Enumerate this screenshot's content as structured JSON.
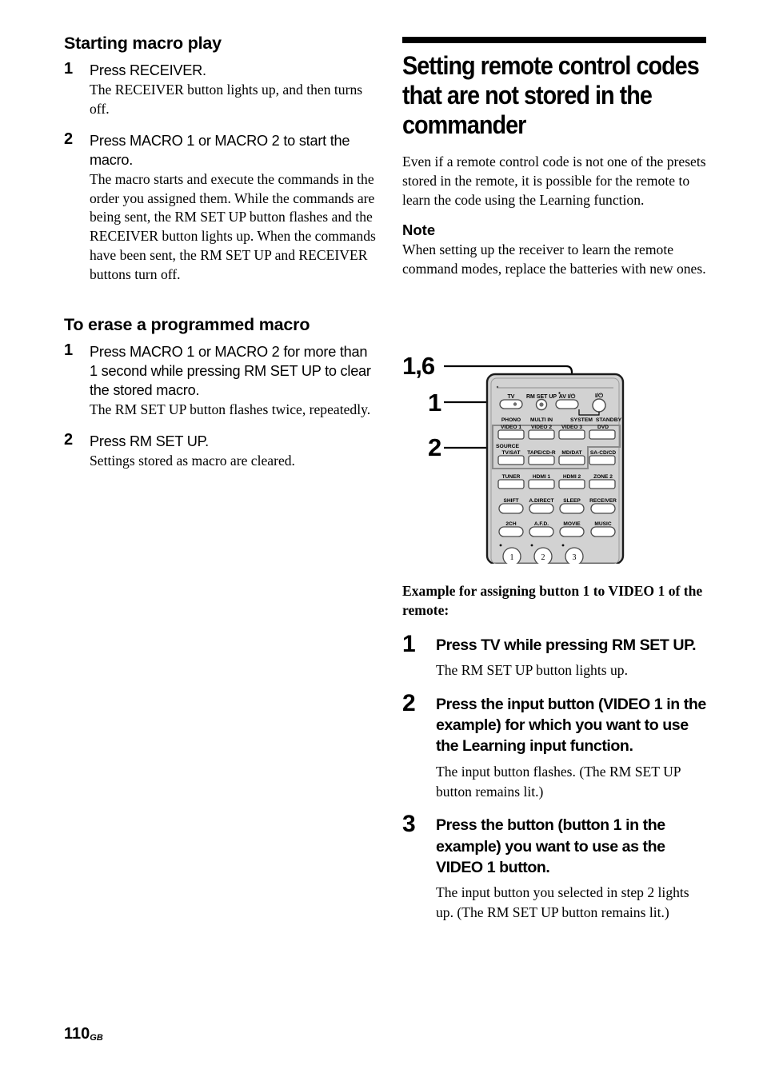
{
  "page": {
    "number": "110",
    "region_code": "GB"
  },
  "left_column": {
    "section1": {
      "heading": "Starting macro play",
      "steps": [
        {
          "num": "1",
          "title": "Press RECEIVER.",
          "body": "The RECEIVER button lights up, and then turns off."
        },
        {
          "num": "2",
          "title": "Press MACRO 1 or MACRO 2 to start the macro.",
          "body": "The macro starts and execute the commands in the order you assigned them. While the commands are being sent, the RM SET UP button flashes and the RECEIVER button lights up. When the commands have been sent, the RM SET UP and RECEIVER buttons turn off."
        }
      ]
    },
    "section2": {
      "heading": "To erase a programmed macro",
      "steps": [
        {
          "num": "1",
          "title": "Press MACRO 1 or MACRO 2 for more than 1 second while pressing RM SET UP to clear the stored macro.",
          "body": "The RM SET UP button flashes twice, repeatedly."
        },
        {
          "num": "2",
          "title": "Press RM SET UP.",
          "body": "Settings stored as macro are cleared."
        }
      ]
    }
  },
  "right_column": {
    "heading": "Setting remote control codes that are not stored in the commander",
    "intro": "Even if a remote control code is not one of the presets stored in the remote, it is possible for the remote to learn the code using the Learning function.",
    "note_heading": "Note",
    "note_body": "When setting up the receiver to learn the remote command modes, replace the batteries with new ones.",
    "example_heading": "Example for assigning button 1 to VIDEO 1 of the remote:",
    "steps": [
      {
        "num": "1",
        "title": "Press TV while pressing RM SET UP.",
        "body": "The RM SET UP button lights up."
      },
      {
        "num": "2",
        "title": "Press the input button (VIDEO 1 in the example) for which you want to use the Learning input function.",
        "body": "The input button flashes. (The RM SET UP button remains lit.)"
      },
      {
        "num": "3",
        "title": "Press the button (button 1 in the example) you want to use as the VIDEO 1 button.",
        "body": "The input button you selected in step 2 lights up. (The RM SET UP button remains lit.)"
      }
    ]
  },
  "figure": {
    "callouts": [
      {
        "label": "1,6",
        "target": "rm-set-up-button"
      },
      {
        "label": "1",
        "target": "tv-button"
      },
      {
        "label": "2",
        "target": "input-buttons-group"
      }
    ],
    "remote": {
      "body_color": "#d2d2d2",
      "button_color": "#ffffff",
      "outline_color": "#1a1a1a",
      "row_top": [
        "TV",
        "RM SET UP",
        "AV I/⏻",
        "I/⏻"
      ],
      "labels_upper": [
        "PHONO",
        "MULTI IN",
        "SYSTEM",
        "STANDBY"
      ],
      "row_inputs_1": [
        "VIDEO 1",
        "VIDEO 2",
        "VIDEO 3",
        "DVD"
      ],
      "source_label": "SOURCE",
      "row_inputs_2": [
        "TV/SAT",
        "TAPE/CD-R",
        "MD/DAT",
        "SA-CD/CD"
      ],
      "row_inputs_3": [
        "TUNER",
        "HDMI 1",
        "HDMI 2",
        "ZONE 2"
      ],
      "row_mode_1": [
        "SHIFT",
        "A.DIRECT",
        "SLEEP",
        "RECEIVER"
      ],
      "row_mode_2": [
        "2CH",
        "A.F.D.",
        "MOVIE",
        "MUSIC"
      ],
      "row_numeric": [
        "1",
        "2",
        "3"
      ]
    }
  }
}
